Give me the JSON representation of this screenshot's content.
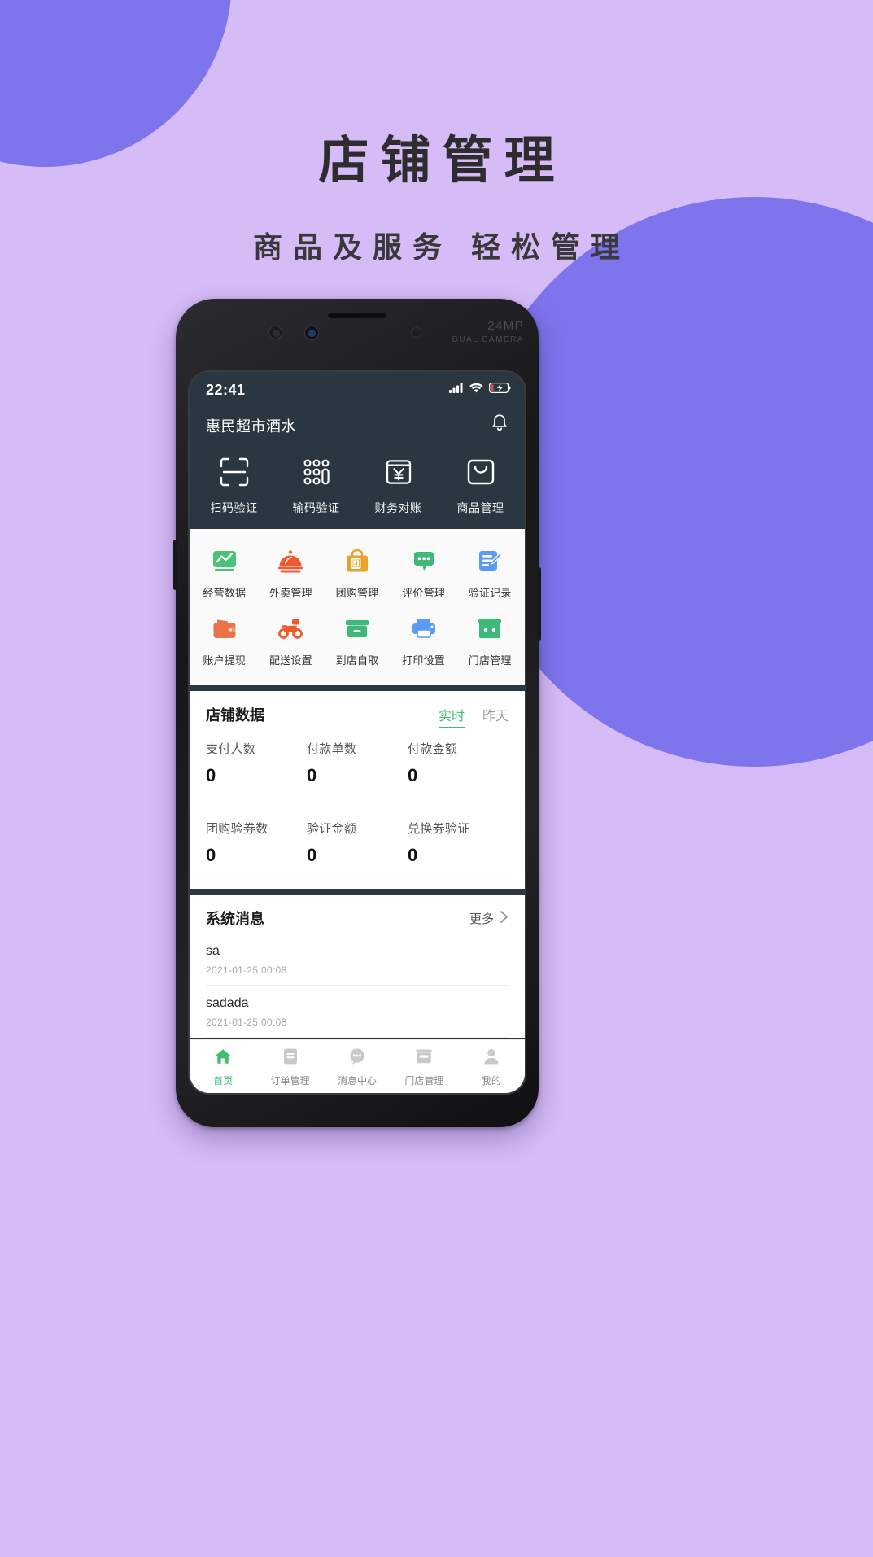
{
  "promo": {
    "title": "店铺管理",
    "subtitle": "商品及服务 轻松管理",
    "bg_color": "#d6bcf7",
    "accent_color": "#7e74ec"
  },
  "device": {
    "camera_mp": "24MP",
    "camera_dual": "DUAL CAMERA"
  },
  "status_bar": {
    "time": "22:41",
    "signal_icon": "signal-bars-icon",
    "wifi_icon": "wifi-icon",
    "battery_icon": "battery-charging-icon"
  },
  "header": {
    "shop_name": "惠民超市酒水",
    "bell_icon": "bell-icon"
  },
  "quick_actions": [
    {
      "label": "扫码验证",
      "icon": "scan-code-icon"
    },
    {
      "label": "输码验证",
      "icon": "keypad-icon"
    },
    {
      "label": "财务对账",
      "icon": "yen-receipt-icon"
    },
    {
      "label": "商品管理",
      "icon": "shopping-bag-icon"
    }
  ],
  "grid": {
    "rows": [
      [
        {
          "label": "经营数据",
          "icon": "chart-line-icon",
          "color": "#4cc178"
        },
        {
          "label": "外卖管理",
          "icon": "food-cloche-icon",
          "color": "#ef5a33"
        },
        {
          "label": "团购管理",
          "icon": "group-buy-bag-icon",
          "color": "#e8a32a"
        },
        {
          "label": "评价管理",
          "icon": "comment-bubble-icon",
          "color": "#3fb97a"
        },
        {
          "label": "验证记录",
          "icon": "document-edit-icon",
          "color": "#5b9bf3"
        }
      ],
      [
        {
          "label": "账户提现",
          "icon": "wallet-icon",
          "color": "#e97248"
        },
        {
          "label": "配送设置",
          "icon": "scooter-icon",
          "color": "#f05a2b"
        },
        {
          "label": "到店自取",
          "icon": "box-icon",
          "color": "#3fb97a"
        },
        {
          "label": "打印设置",
          "icon": "printer-icon",
          "color": "#5b9bf3"
        },
        {
          "label": "门店管理",
          "icon": "storefront-icon",
          "color": "#3fb97a"
        }
      ]
    ]
  },
  "shop_data": {
    "title": "店铺数据",
    "tabs": [
      {
        "label": "实时",
        "active": true
      },
      {
        "label": "昨天",
        "active": false
      }
    ],
    "accent_color": "#3ec06e",
    "stats_row1": [
      {
        "label": "支付人数",
        "value": "0"
      },
      {
        "label": "付款单数",
        "value": "0"
      },
      {
        "label": "付款金额",
        "value": "0"
      }
    ],
    "stats_row2": [
      {
        "label": "团购验券数",
        "value": "0"
      },
      {
        "label": "验证金额",
        "value": "0"
      },
      {
        "label": "兑换券验证",
        "value": "0"
      }
    ]
  },
  "messages": {
    "title": "系统消息",
    "more_label": "更多",
    "more_icon": "chevron-right-icon",
    "items": [
      {
        "text": "sa",
        "time": "2021-01-25 00:08"
      },
      {
        "text": "sadada",
        "time": "2021-01-25 00:08"
      }
    ]
  },
  "tab_bar": {
    "items": [
      {
        "label": "首页",
        "icon": "home-icon",
        "active": true
      },
      {
        "label": "订单管理",
        "icon": "order-list-icon",
        "active": false
      },
      {
        "label": "消息中心",
        "icon": "message-bubble-icon",
        "active": false
      },
      {
        "label": "门店管理",
        "icon": "storefront-icon",
        "active": false
      },
      {
        "label": "我的",
        "icon": "user-icon",
        "active": false
      }
    ],
    "active_color": "#3ec06e",
    "inactive_color": "#c9c9c9"
  }
}
